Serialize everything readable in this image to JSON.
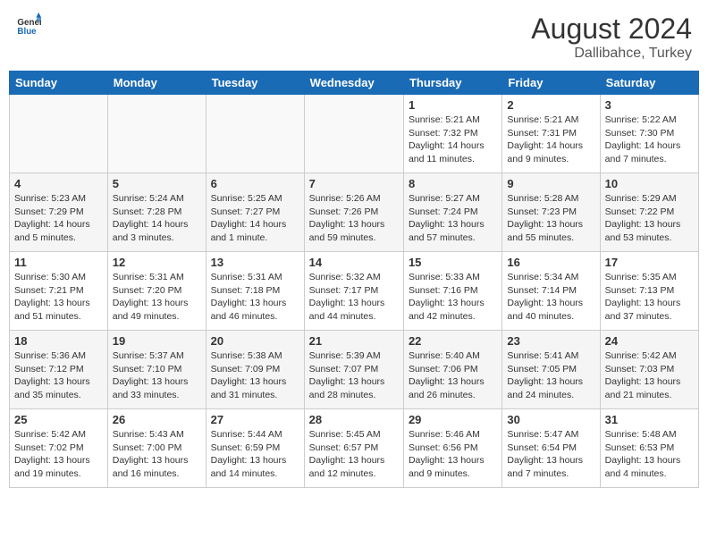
{
  "header": {
    "logo_general": "General",
    "logo_blue": "Blue",
    "title": "August 2024",
    "subtitle": "Dallibahce, Turkey"
  },
  "days_of_week": [
    "Sunday",
    "Monday",
    "Tuesday",
    "Wednesday",
    "Thursday",
    "Friday",
    "Saturday"
  ],
  "weeks": [
    [
      {
        "day": "",
        "info": ""
      },
      {
        "day": "",
        "info": ""
      },
      {
        "day": "",
        "info": ""
      },
      {
        "day": "",
        "info": ""
      },
      {
        "day": "1",
        "info": "Sunrise: 5:21 AM\nSunset: 7:32 PM\nDaylight: 14 hours and 11 minutes."
      },
      {
        "day": "2",
        "info": "Sunrise: 5:21 AM\nSunset: 7:31 PM\nDaylight: 14 hours and 9 minutes."
      },
      {
        "day": "3",
        "info": "Sunrise: 5:22 AM\nSunset: 7:30 PM\nDaylight: 14 hours and 7 minutes."
      }
    ],
    [
      {
        "day": "4",
        "info": "Sunrise: 5:23 AM\nSunset: 7:29 PM\nDaylight: 14 hours and 5 minutes."
      },
      {
        "day": "5",
        "info": "Sunrise: 5:24 AM\nSunset: 7:28 PM\nDaylight: 14 hours and 3 minutes."
      },
      {
        "day": "6",
        "info": "Sunrise: 5:25 AM\nSunset: 7:27 PM\nDaylight: 14 hours and 1 minute."
      },
      {
        "day": "7",
        "info": "Sunrise: 5:26 AM\nSunset: 7:26 PM\nDaylight: 13 hours and 59 minutes."
      },
      {
        "day": "8",
        "info": "Sunrise: 5:27 AM\nSunset: 7:24 PM\nDaylight: 13 hours and 57 minutes."
      },
      {
        "day": "9",
        "info": "Sunrise: 5:28 AM\nSunset: 7:23 PM\nDaylight: 13 hours and 55 minutes."
      },
      {
        "day": "10",
        "info": "Sunrise: 5:29 AM\nSunset: 7:22 PM\nDaylight: 13 hours and 53 minutes."
      }
    ],
    [
      {
        "day": "11",
        "info": "Sunrise: 5:30 AM\nSunset: 7:21 PM\nDaylight: 13 hours and 51 minutes."
      },
      {
        "day": "12",
        "info": "Sunrise: 5:31 AM\nSunset: 7:20 PM\nDaylight: 13 hours and 49 minutes."
      },
      {
        "day": "13",
        "info": "Sunrise: 5:31 AM\nSunset: 7:18 PM\nDaylight: 13 hours and 46 minutes."
      },
      {
        "day": "14",
        "info": "Sunrise: 5:32 AM\nSunset: 7:17 PM\nDaylight: 13 hours and 44 minutes."
      },
      {
        "day": "15",
        "info": "Sunrise: 5:33 AM\nSunset: 7:16 PM\nDaylight: 13 hours and 42 minutes."
      },
      {
        "day": "16",
        "info": "Sunrise: 5:34 AM\nSunset: 7:14 PM\nDaylight: 13 hours and 40 minutes."
      },
      {
        "day": "17",
        "info": "Sunrise: 5:35 AM\nSunset: 7:13 PM\nDaylight: 13 hours and 37 minutes."
      }
    ],
    [
      {
        "day": "18",
        "info": "Sunrise: 5:36 AM\nSunset: 7:12 PM\nDaylight: 13 hours and 35 minutes."
      },
      {
        "day": "19",
        "info": "Sunrise: 5:37 AM\nSunset: 7:10 PM\nDaylight: 13 hours and 33 minutes."
      },
      {
        "day": "20",
        "info": "Sunrise: 5:38 AM\nSunset: 7:09 PM\nDaylight: 13 hours and 31 minutes."
      },
      {
        "day": "21",
        "info": "Sunrise: 5:39 AM\nSunset: 7:07 PM\nDaylight: 13 hours and 28 minutes."
      },
      {
        "day": "22",
        "info": "Sunrise: 5:40 AM\nSunset: 7:06 PM\nDaylight: 13 hours and 26 minutes."
      },
      {
        "day": "23",
        "info": "Sunrise: 5:41 AM\nSunset: 7:05 PM\nDaylight: 13 hours and 24 minutes."
      },
      {
        "day": "24",
        "info": "Sunrise: 5:42 AM\nSunset: 7:03 PM\nDaylight: 13 hours and 21 minutes."
      }
    ],
    [
      {
        "day": "25",
        "info": "Sunrise: 5:42 AM\nSunset: 7:02 PM\nDaylight: 13 hours and 19 minutes."
      },
      {
        "day": "26",
        "info": "Sunrise: 5:43 AM\nSunset: 7:00 PM\nDaylight: 13 hours and 16 minutes."
      },
      {
        "day": "27",
        "info": "Sunrise: 5:44 AM\nSunset: 6:59 PM\nDaylight: 13 hours and 14 minutes."
      },
      {
        "day": "28",
        "info": "Sunrise: 5:45 AM\nSunset: 6:57 PM\nDaylight: 13 hours and 12 minutes."
      },
      {
        "day": "29",
        "info": "Sunrise: 5:46 AM\nSunset: 6:56 PM\nDaylight: 13 hours and 9 minutes."
      },
      {
        "day": "30",
        "info": "Sunrise: 5:47 AM\nSunset: 6:54 PM\nDaylight: 13 hours and 7 minutes."
      },
      {
        "day": "31",
        "info": "Sunrise: 5:48 AM\nSunset: 6:53 PM\nDaylight: 13 hours and 4 minutes."
      }
    ]
  ]
}
